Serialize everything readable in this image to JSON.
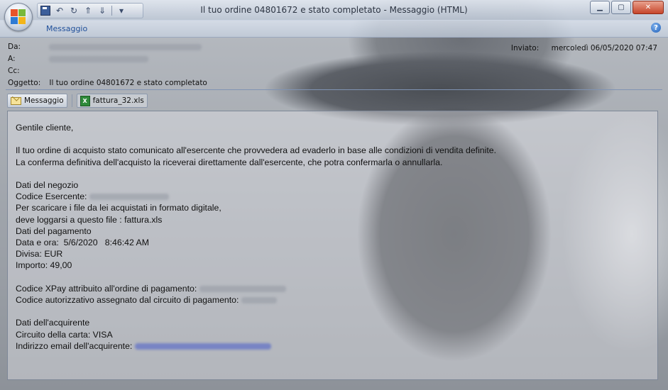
{
  "window": {
    "title": "Il tuo ordine 04801672 e stato completato - Messaggio (HTML)",
    "min_icon": "minimize-icon",
    "max_icon": "maximize-icon",
    "close_label": "✕"
  },
  "ribbon": {
    "tab": "Messaggio",
    "help": "?"
  },
  "header": {
    "from_label": "Da:",
    "to_label": "A:",
    "cc_label": "Cc:",
    "subject_label": "Oggetto:",
    "subject": "Il tuo ordine 04801672 e stato completato",
    "sent_label": "Inviato:",
    "sent_value": "mercoledì 06/05/2020 07:47"
  },
  "attachments": {
    "message_label": "Messaggio",
    "file_name": "fattura_32.xls"
  },
  "body": {
    "greeting": "Gentile cliente,",
    "para1_l1": "Il tuo ordine di acquisto stato comunicato all'esercente che provvedera ad evaderlo in base alle condizioni di vendita definite.",
    "para1_l2": "La conferma definitiva dell'acquisto la riceverai direttamente dall'esercente, che potra confermarla o annullarla.",
    "shop_title": "Dati del negozio",
    "shop_code_label": "Codice Esercente:",
    "download_l1": "Per scaricare i file da lei acquistati in formato digitale,",
    "download_l2": "deve loggarsi a questo file : fattura.xls",
    "payment_title": "Dati del pagamento",
    "datetime": "Data e ora:  5/6/2020   8:46:42 AM",
    "currency": "Divisa: EUR",
    "amount": "Importo: 49,00",
    "xpay_code_label": "Codice XPay attribuito all'ordine di pagamento:",
    "auth_code_label": "Codice autorizzativo assegnato dal circuito di pagamento:",
    "buyer_title": "Dati dell'acquirente",
    "card_circuit": "Circuito della carta: VISA",
    "buyer_email_label": "Indirizzo email dell'acquirente:"
  }
}
